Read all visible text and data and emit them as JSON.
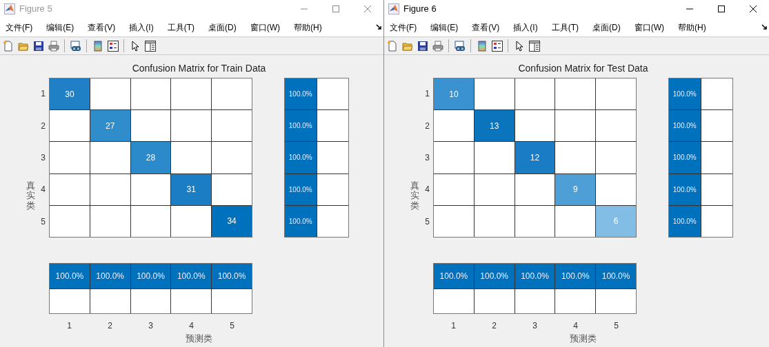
{
  "windows": [
    {
      "title": "Figure 5",
      "active": false,
      "menu": [
        "文件(F)",
        "编辑(E)",
        "查看(V)",
        "插入(I)",
        "工具(T)",
        "桌面(D)",
        "窗口(W)",
        "帮助(H)"
      ],
      "chart": {
        "title": "Confusion Matrix for Train Data",
        "ylabel": "真实类",
        "xlabel": "预测类",
        "row_labels": [
          "1",
          "2",
          "3",
          "4",
          "5"
        ],
        "column_labels": [
          "1",
          "2",
          "3",
          "4",
          "5"
        ],
        "diagonal": [
          {
            "count": "30",
            "color": "#1f80c6"
          },
          {
            "count": "27",
            "color": "#308dcb"
          },
          {
            "count": "28",
            "color": "#2b8ac9"
          },
          {
            "count": "31",
            "color": "#1b7ec5"
          },
          {
            "count": "34",
            "color": "#0072bd"
          }
        ],
        "row_summary": [
          "100.0%",
          "100.0%",
          "100.0%",
          "100.0%",
          "100.0%"
        ],
        "column_summary": [
          "100.0%",
          "100.0%",
          "100.0%",
          "100.0%",
          "100.0%"
        ]
      }
    },
    {
      "title": "Figure 6",
      "active": true,
      "menu": [
        "文件(F)",
        "编辑(E)",
        "查看(V)",
        "插入(I)",
        "工具(T)",
        "桌面(D)",
        "窗口(W)",
        "帮助(H)"
      ],
      "chart": {
        "title": "Confusion Matrix for Test Data",
        "ylabel": "真实类",
        "xlabel": "预测类",
        "row_labels": [
          "1",
          "2",
          "3",
          "4",
          "5"
        ],
        "column_labels": [
          "1",
          "2",
          "3",
          "4",
          "5"
        ],
        "diagonal": [
          {
            "count": "10",
            "color": "#3a92d0"
          },
          {
            "count": "13",
            "color": "#0a74bd"
          },
          {
            "count": "12",
            "color": "#1a7cc4"
          },
          {
            "count": "9",
            "color": "#4e9fd5"
          },
          {
            "count": "6",
            "color": "#82bde5"
          }
        ],
        "row_summary": [
          "100.0%",
          "100.0%",
          "100.0%",
          "100.0%",
          "100.0%"
        ],
        "column_summary": [
          "100.0%",
          "100.0%",
          "100.0%",
          "100.0%",
          "100.0%"
        ]
      }
    }
  ]
}
